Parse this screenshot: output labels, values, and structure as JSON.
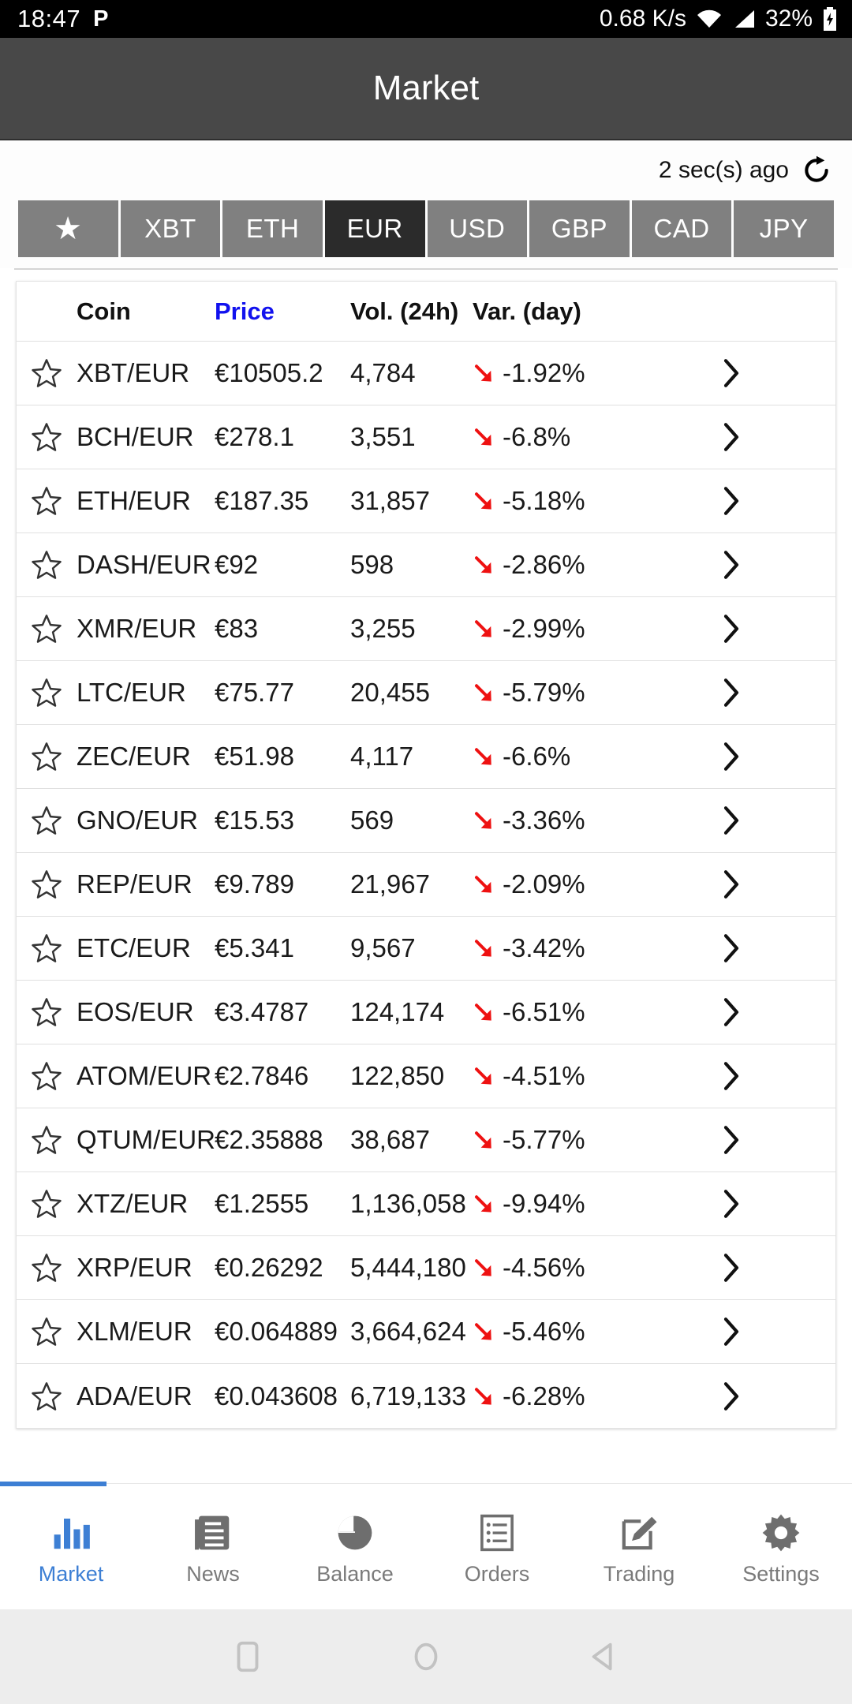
{
  "status_bar": {
    "time": "18:47",
    "app_icon": "p-icon",
    "network_rate": "0.68 K/s",
    "battery": "32%"
  },
  "header": {
    "title": "Market"
  },
  "refresh": {
    "last_updated": "2 sec(s) ago",
    "icon": "refresh-icon"
  },
  "currency_tabs": {
    "selected": "EUR",
    "items": [
      {
        "label": "★",
        "name": "favorites",
        "is_star": true
      },
      {
        "label": "XBT",
        "name": "xbt"
      },
      {
        "label": "ETH",
        "name": "eth"
      },
      {
        "label": "EUR",
        "name": "eur"
      },
      {
        "label": "USD",
        "name": "usd"
      },
      {
        "label": "GBP",
        "name": "gbp"
      },
      {
        "label": "CAD",
        "name": "cad"
      },
      {
        "label": "JPY",
        "name": "jpy"
      }
    ]
  },
  "table": {
    "columns": {
      "coin": "Coin",
      "price": "Price",
      "volume": "Vol. (24h)",
      "variation": "Var. (day)"
    },
    "sorted_by": "Price",
    "sort_color": "#1111ee",
    "down_color": "#ee1111",
    "rows": [
      {
        "pair": "XBT/EUR",
        "price": "€10505.2",
        "volume": "4,784",
        "variation": "-1.92%",
        "trend": "down"
      },
      {
        "pair": "BCH/EUR",
        "price": "€278.1",
        "volume": "3,551",
        "variation": "-6.8%",
        "trend": "down"
      },
      {
        "pair": "ETH/EUR",
        "price": "€187.35",
        "volume": "31,857",
        "variation": "-5.18%",
        "trend": "down"
      },
      {
        "pair": "DASH/EUR",
        "price": "€92",
        "volume": "598",
        "variation": "-2.86%",
        "trend": "down"
      },
      {
        "pair": "XMR/EUR",
        "price": "€83",
        "volume": "3,255",
        "variation": "-2.99%",
        "trend": "down"
      },
      {
        "pair": "LTC/EUR",
        "price": "€75.77",
        "volume": "20,455",
        "variation": "-5.79%",
        "trend": "down"
      },
      {
        "pair": "ZEC/EUR",
        "price": "€51.98",
        "volume": "4,117",
        "variation": "-6.6%",
        "trend": "down"
      },
      {
        "pair": "GNO/EUR",
        "price": "€15.53",
        "volume": "569",
        "variation": "-3.36%",
        "trend": "down"
      },
      {
        "pair": "REP/EUR",
        "price": "€9.789",
        "volume": "21,967",
        "variation": "-2.09%",
        "trend": "down"
      },
      {
        "pair": "ETC/EUR",
        "price": "€5.341",
        "volume": "9,567",
        "variation": "-3.42%",
        "trend": "down"
      },
      {
        "pair": "EOS/EUR",
        "price": "€3.4787",
        "volume": "124,174",
        "variation": "-6.51%",
        "trend": "down"
      },
      {
        "pair": "ATOM/EUR",
        "price": "€2.7846",
        "volume": "122,850",
        "variation": "-4.51%",
        "trend": "down"
      },
      {
        "pair": "QTUM/EUR",
        "price": "€2.35888",
        "volume": "38,687",
        "variation": "-5.77%",
        "trend": "down"
      },
      {
        "pair": "XTZ/EUR",
        "price": "€1.2555",
        "volume": "1,136,058",
        "variation": "-9.94%",
        "trend": "down"
      },
      {
        "pair": "XRP/EUR",
        "price": "€0.26292",
        "volume": "5,444,180",
        "variation": "-4.56%",
        "trend": "down"
      },
      {
        "pair": "XLM/EUR",
        "price": "€0.064889",
        "volume": "3,664,624",
        "variation": "-5.46%",
        "trend": "down"
      },
      {
        "pair": "ADA/EUR",
        "price": "€0.043608",
        "volume": "6,719,133",
        "variation": "-6.28%",
        "trend": "down"
      }
    ]
  },
  "bottom_nav": {
    "active": "Market",
    "active_color": "#3d7fd4",
    "items": [
      {
        "label": "Market",
        "icon": "bar-chart-icon"
      },
      {
        "label": "News",
        "icon": "news-document-icon"
      },
      {
        "label": "Balance",
        "icon": "pie-chart-icon"
      },
      {
        "label": "Orders",
        "icon": "list-icon"
      },
      {
        "label": "Trading",
        "icon": "edit-pencil-icon"
      },
      {
        "label": "Settings",
        "icon": "gear-icon"
      }
    ]
  },
  "android_nav": {
    "recents": "square-icon",
    "home": "circle-icon",
    "back": "triangle-left-icon"
  }
}
